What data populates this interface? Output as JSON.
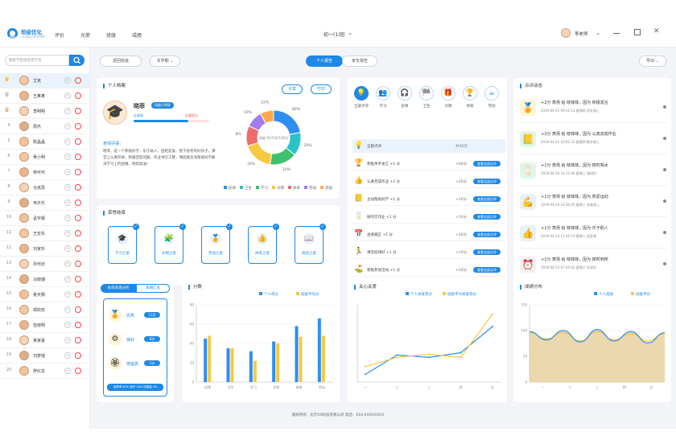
{
  "header": {
    "brand": "班级优化",
    "brand_sub": "CLASS HELPER",
    "nav": [
      "评价",
      "光荣",
      "班级",
      "成绩"
    ],
    "class_title": "初一(1)班",
    "user_name": "李老师"
  },
  "sidebar": {
    "search_placeholder": "搜索学生姓名或学号",
    "students": [
      {
        "rank": "1",
        "name": "艾克"
      },
      {
        "rank": "2",
        "name": "王某某"
      },
      {
        "rank": "3",
        "name": "李明明"
      },
      {
        "rank": "4",
        "name": "周杰"
      },
      {
        "rank": "5",
        "name": "陈晶晶"
      },
      {
        "rank": "6",
        "name": "吴小明"
      },
      {
        "rank": "7",
        "name": "林可可"
      },
      {
        "rank": "8",
        "name": "马克思"
      },
      {
        "rank": "9",
        "name": "韦乐乐"
      },
      {
        "rank": "10",
        "name": "孟宇晨"
      },
      {
        "rank": "11",
        "name": "王宏东"
      },
      {
        "rank": "12",
        "name": "刘家乐"
      },
      {
        "rank": "13",
        "name": "孙可欣"
      },
      {
        "rank": "14",
        "name": "马晓瑞"
      },
      {
        "rank": "15",
        "name": "吴天赐"
      },
      {
        "rank": "16",
        "name": "郑欢欢"
      },
      {
        "rank": "17",
        "name": "伍晓明"
      },
      {
        "rank": "18",
        "name": "吴家豪"
      },
      {
        "rank": "19",
        "name": "刘梦瑶"
      },
      {
        "rank": "20",
        "name": "罗红龙"
      }
    ],
    "plus": "+",
    "minus": "-"
  },
  "toolbar": {
    "back": "返回班级",
    "term": "本学期",
    "tab_personal": "个人报告",
    "tab_family": "家长报告",
    "export": "导出"
  },
  "profile": {
    "title": "个人档案",
    "btn_share": "分享",
    "btn_print": "打印",
    "name": "晓菲",
    "badge": "班级小明星",
    "progress_left": "总表现",
    "progress_right": "总表现分",
    "progress_value": 0.72,
    "comment_title": "老师评语：",
    "comment": "晓菲，是一个积极好学，乐于助人，团结友爱、善于思考的好孩子。课堂上认真听讲，积极回答问题，作业书写工整，课后能主动帮助同学解决学习上的困难，继续加油！",
    "donut_center": "班级 90/500/100分"
  },
  "donut": {
    "labels": [
      "纪律",
      "卫生",
      "学习",
      "文明",
      "体育",
      "劳动",
      "其他"
    ],
    "values": [
      22,
      14,
      16,
      18,
      12,
      10,
      8
    ],
    "outer_labels": [
      "80%",
      "20%",
      "10%",
      "16%",
      "8%",
      "10%",
      "12%"
    ],
    "colors": [
      "#2f8ef0",
      "#27c3c7",
      "#3ec06e",
      "#f7c841",
      "#f06b6b",
      "#a37ded",
      "#ffa94d"
    ]
  },
  "honors": {
    "title": "荣誉勋章",
    "items": [
      {
        "label": "学习之星",
        "icon": "🎓"
      },
      {
        "label": "文明之星",
        "icon": "🧩"
      },
      {
        "label": "劳动之星",
        "icon": "🏅"
      },
      {
        "label": "体育之星",
        "icon": "👍"
      },
      {
        "label": "阅读之星",
        "icon": "📖"
      }
    ]
  },
  "categories": {
    "items": [
      {
        "label": "全部点评",
        "icon": "💡"
      },
      {
        "label": "学习",
        "icon": "👥"
      },
      {
        "label": "纪律",
        "icon": "🎧"
      },
      {
        "label": "卫生",
        "icon": "🏁"
      },
      {
        "label": "文明",
        "icon": "🎁"
      },
      {
        "label": "体育",
        "icon": "🏆"
      },
      {
        "label": "劳动",
        "icon": "☕"
      }
    ],
    "rows": [
      {
        "icon": "💡",
        "text": "全部点评",
        "score": "共56次",
        "btn": ""
      },
      {
        "icon": "🏆",
        "text": "积极举手发言 +1 分",
        "score": "+60分",
        "btn": "查看全部点评"
      },
      {
        "icon": "👍",
        "text": "认真完成作业 +2 分",
        "score": "+40分",
        "btn": "查看全部点评"
      },
      {
        "icon": "📒",
        "text": "主动帮助同学 +1 分",
        "score": "+20分",
        "btn": "查看全部点评"
      },
      {
        "icon": "🥛",
        "text": "按时交作业 +1 分",
        "score": "+10分",
        "btn": "查看全部点评"
      },
      {
        "icon": "📅",
        "text": "坐姿端正 +1 分",
        "score": "+20分",
        "btn": "查看全部点评"
      },
      {
        "icon": "🏃",
        "text": "课堂纪律好 +1 分",
        "score": "+10分",
        "btn": "查看全部点评"
      },
      {
        "icon": "⛳",
        "text": "积极参加活动 +1 分",
        "score": "+20分",
        "btn": "查看全部点评"
      }
    ]
  },
  "feed": {
    "title": "点评动态",
    "items": [
      {
        "icon": "🏅",
        "line": "+2分 表扬 给 晓菲菲，因为 积极发言",
        "time": "2019-04-25  09:12:11  星期四  语文课上"
      },
      {
        "icon": "📒",
        "line": "+2分 表扬 给 晓菲菲，因为 认真完成作业",
        "time": "2019-04-25  10:02:31  星期四  数学课上"
      },
      {
        "icon": "🥛",
        "line": "+1分 表扬 给 晓菲菲，因为 按时喝水",
        "time": "2019-04-24  14:22:08  星期三  课间时"
      },
      {
        "icon": "💪",
        "line": "+1分 表扬 给 晓菲菲，因为 热爱运动",
        "time": "2019-04-24  16:30:45  星期三  体育课上"
      },
      {
        "icon": "👍",
        "line": "+1分 表扬 给 晓菲菲，因为 乐于助人",
        "time": "2019-04-23  11:05:19  星期二  班会课"
      },
      {
        "icon": "⏰",
        "line": "+1分 表扬 给 晓菲菲，因为 按时到校",
        "time": "2019-04-23  07:45:02  星期二  早读时"
      }
    ]
  },
  "growth": {
    "tab_on": "本周表现分析",
    "tab_off": "本期汇总",
    "items": [
      {
        "label": "优秀",
        "icon": "🏅",
        "value": "12次"
      },
      {
        "label": "良好",
        "icon": "⚙",
        "value": "8次"
      },
      {
        "label": "待提高",
        "icon": "🏵",
        "value": "2次"
      }
    ],
    "footer": "优秀率 80%  良好 16%  待提高 4%"
  },
  "chart_data": [
    {
      "type": "bar",
      "title": "分数",
      "categories": [
        "纪律",
        "卫生",
        "学习",
        "文明",
        "体育",
        "劳动"
      ],
      "series": [
        {
          "name": "个人得分",
          "values": [
            45,
            35,
            32,
            42,
            58,
            66
          ],
          "color": "#2f8ef0"
        },
        {
          "name": "班级平均分",
          "values": [
            48,
            35,
            22,
            40,
            47,
            48
          ],
          "color": "#f7c841"
        }
      ],
      "ylim": [
        0,
        80
      ]
    },
    {
      "type": "line",
      "title": "关心关爱",
      "categories": [
        "一",
        "二",
        "三",
        "四",
        "五"
      ],
      "series": [
        {
          "name": "个人关爱得分",
          "values": [
            10,
            35,
            32,
            38,
            72
          ],
          "color": "#2f8ef0"
        },
        {
          "name": "班级平均关爱得分",
          "values": [
            20,
            32,
            36,
            32,
            88
          ],
          "color": "#f7c841"
        }
      ],
      "ylim": [
        0,
        100
      ]
    },
    {
      "type": "area",
      "title": "成绩分布",
      "categories": [
        "一",
        "二",
        "三",
        "四",
        "五"
      ],
      "series": [
        {
          "name": "个人成绩",
          "values": [
            98,
            82,
            100,
            78,
            102,
            80,
            98,
            76,
            96
          ],
          "color": "#2f8ef0"
        },
        {
          "name": "班级平均",
          "values": [
            96,
            84,
            96,
            80,
            98,
            82,
            94,
            80,
            94
          ],
          "color": "#f7c841"
        }
      ],
      "ylim": [
        0,
        150
      ]
    }
  ],
  "footer": {
    "text": "版权所有：北京XX科技有限公司  电话：010-XXXXXXXX"
  }
}
